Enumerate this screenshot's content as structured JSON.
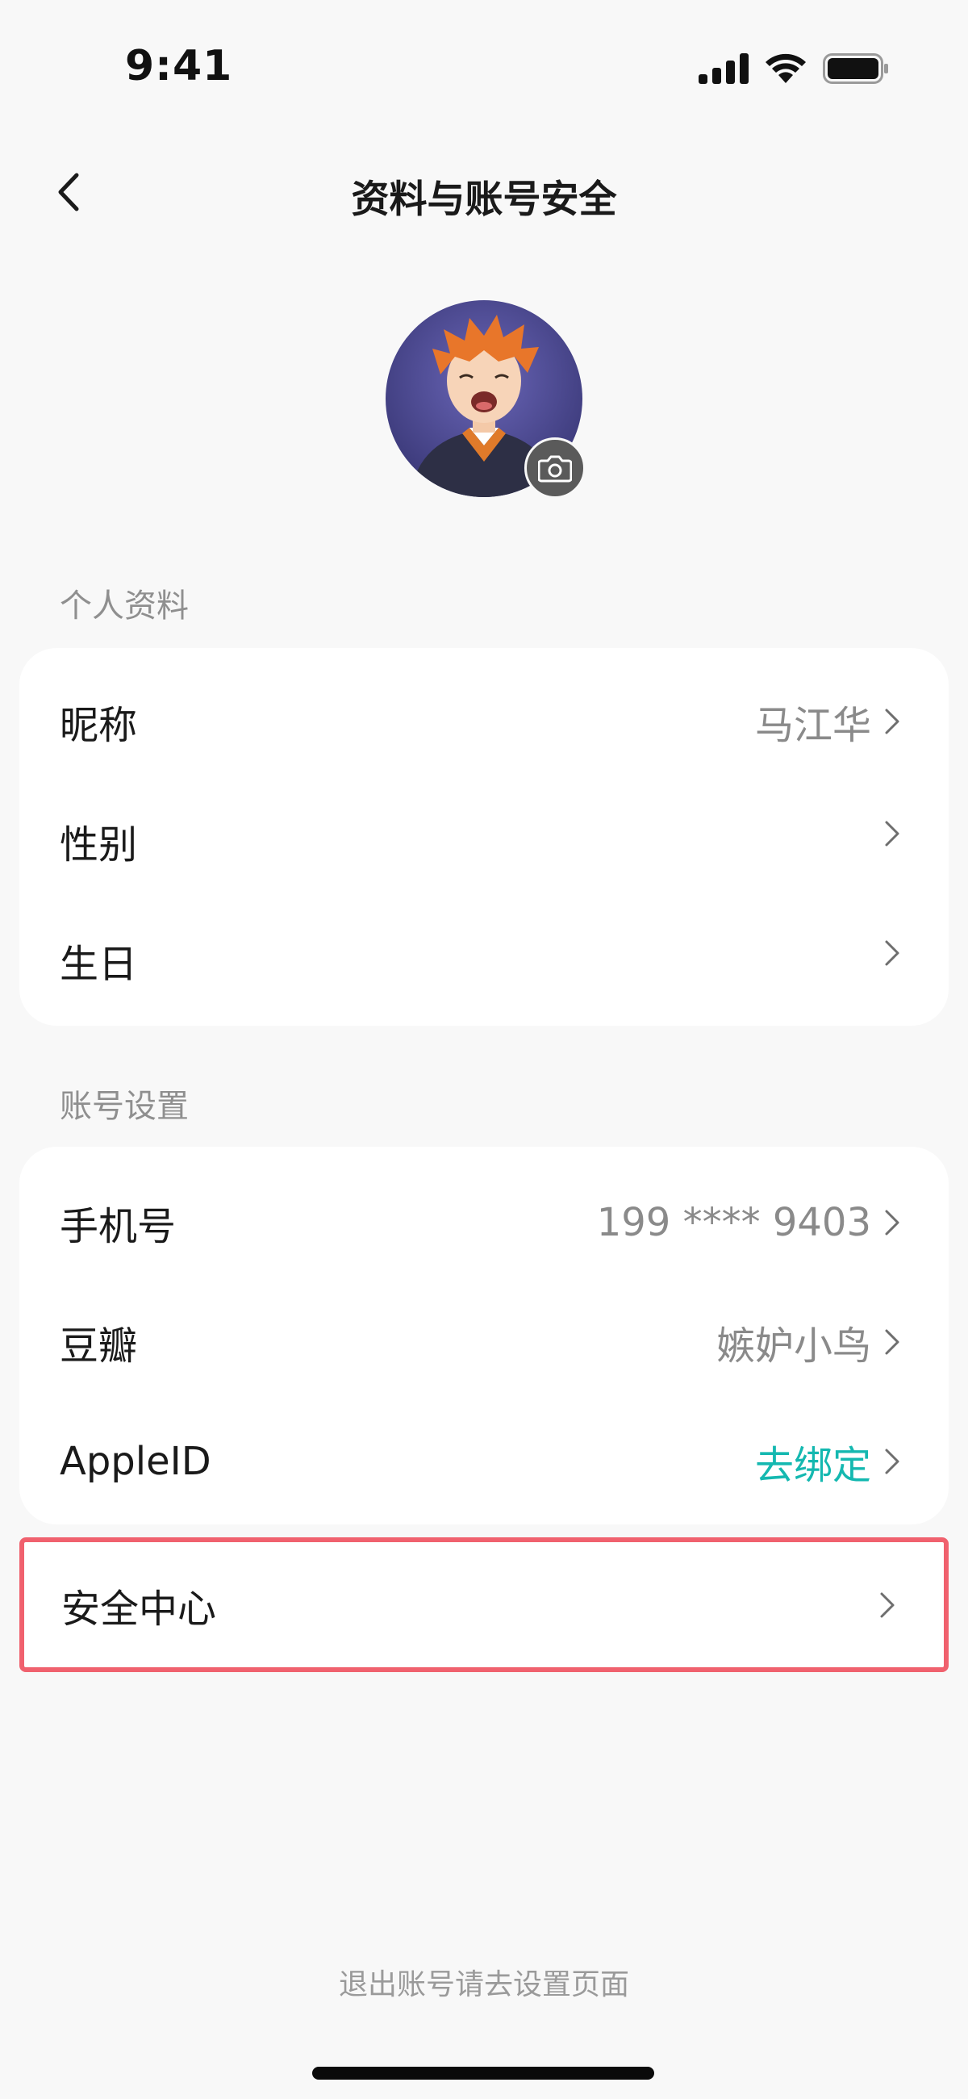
{
  "status_bar": {
    "time": "9:41"
  },
  "nav": {
    "title": "资料与账号安全"
  },
  "profile_section": {
    "label": "个人资料",
    "items": [
      {
        "label": "昵称",
        "value": "马江华"
      },
      {
        "label": "性别",
        "value": ""
      },
      {
        "label": "生日",
        "value": ""
      }
    ]
  },
  "account_section": {
    "label": "账号设置",
    "items": [
      {
        "label": "手机号",
        "value": "199 **** 9403"
      },
      {
        "label": "豆瓣",
        "value": "嫉妒小鸟"
      },
      {
        "label": "AppleID",
        "value": "去绑定"
      }
    ]
  },
  "security": {
    "label": "安全中心"
  },
  "footer": {
    "note": "退出账号请去设置页面"
  },
  "colors": {
    "accent": "#14b8b0",
    "highlight_border": "#f0616e",
    "background": "#f8f8f8"
  }
}
